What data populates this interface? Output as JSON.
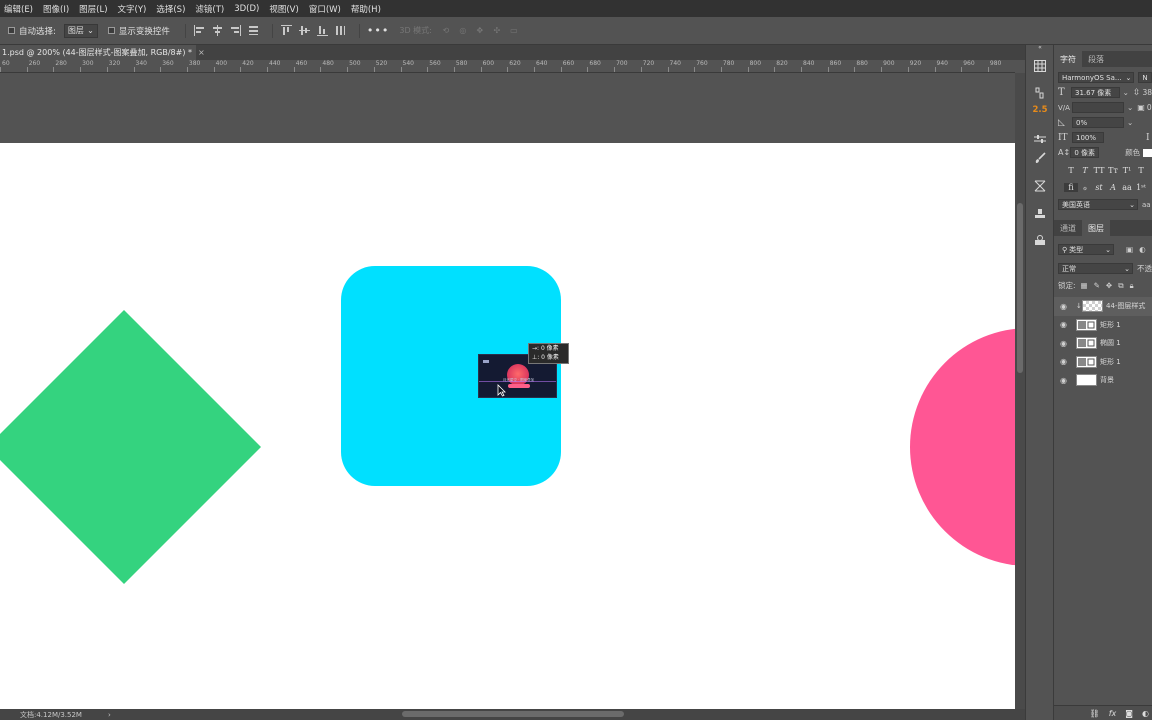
{
  "menu": [
    "编辑(E)",
    "图像(I)",
    "图层(L)",
    "文字(Y)",
    "选择(S)",
    "滤镜(T)",
    "3D(D)",
    "视图(V)",
    "窗口(W)",
    "帮助(H)"
  ],
  "options": {
    "auto_select_label": "自动选择:",
    "auto_select_value": "图层",
    "show_transform_label": "显示变换控件",
    "more": "•••",
    "mode_3d_label": "3D 模式:"
  },
  "tab": {
    "title": "1.psd @ 200% (44-图层样式-图案叠加, RGB/8#) *",
    "close": "×"
  },
  "ruler_labels": [
    "60",
    "260",
    "280",
    "300",
    "320",
    "340",
    "360",
    "380",
    "400",
    "420",
    "440",
    "460",
    "480",
    "500",
    "520",
    "540",
    "560",
    "580",
    "600",
    "620",
    "640",
    "660",
    "680",
    "700",
    "720",
    "740",
    "760",
    "780",
    "800",
    "820",
    "840",
    "860",
    "880",
    "900",
    "920",
    "940",
    "960",
    "980"
  ],
  "transform_tooltip": {
    "line1": "→: 0 像素",
    "line2": "⊥: 0 像素"
  },
  "thumbnail_caption": "月光星空 · 图案叠加",
  "status": {
    "doc": "文档:4.12M/3.52M",
    "arrow": "›"
  },
  "character_panel": {
    "tab_character": "字符",
    "tab_paragraph": "段落",
    "font_family": "HarmonyOS Sa...",
    "font_size": "31.67 像素",
    "tracking": "0%",
    "vertical_scale": "100%",
    "baseline_shift": "0 像素",
    "color_label": "颜色",
    "language": "美国英语",
    "leading_value": "38",
    "kerning_value": "0",
    "small_n": "N",
    "aa_label": "aa"
  },
  "strip": {
    "value_label": "2.5"
  },
  "layers_panel": {
    "tab_channels": "通道",
    "tab_layers": "图层",
    "filter_kind": "类型",
    "blend_mode": "正常",
    "opacity_label": "不透",
    "lock_label": "锁定:",
    "layers": [
      {
        "name": "44-图层样式",
        "selected": true
      },
      {
        "name": "矩形 1",
        "selected": false
      },
      {
        "name": "椭圆 1",
        "selected": false
      },
      {
        "name": "矩形 1",
        "selected": false
      },
      {
        "name": "背景",
        "selected": false
      }
    ]
  },
  "colors": {
    "accent_value": "#e88b1a",
    "diamond": "#34d37f",
    "rounded_square": "#00e0ff",
    "circle": "#ff5694",
    "canvas": "#ffffff"
  }
}
